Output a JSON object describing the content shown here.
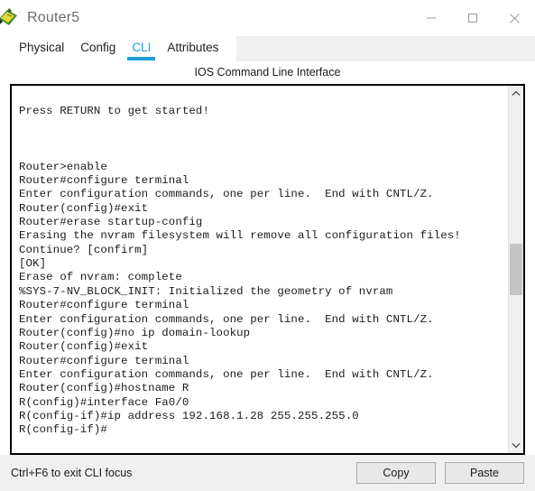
{
  "window": {
    "title": "Router5",
    "icon": "router-device-icon",
    "controls": {
      "minimize_label": "—",
      "maximize_label": "□",
      "close_label": "✕"
    }
  },
  "tabs": [
    {
      "label": "Physical",
      "active": false
    },
    {
      "label": "Config",
      "active": false
    },
    {
      "label": "CLI",
      "active": true
    },
    {
      "label": "Attributes",
      "active": false
    }
  ],
  "panel": {
    "title": "IOS Command Line Interface"
  },
  "terminal": {
    "lines": [
      "",
      "Press RETURN to get started!",
      "",
      "",
      "",
      "Router>enable",
      "Router#configure terminal",
      "Enter configuration commands, one per line.  End with CNTL/Z.",
      "Router(config)#exit",
      "Router#erase startup-config",
      "Erasing the nvram filesystem will remove all configuration files!",
      "Continue? [confirm]",
      "[OK]",
      "Erase of nvram: complete",
      "%SYS-7-NV_BLOCK_INIT: Initialized the geometry of nvram",
      "Router#configure terminal",
      "Enter configuration commands, one per line.  End with CNTL/Z.",
      "Router(config)#no ip domain-lookup",
      "Router(config)#exit",
      "Router#configure terminal",
      "Enter configuration commands, one per line.  End with CNTL/Z.",
      "Router(config)#hostname R",
      "R(config)#interface Fa0/0",
      "R(config-if)#ip address 192.168.1.28 255.255.255.0",
      "R(config-if)#"
    ]
  },
  "scrollbar": {
    "up_arrow": "chevron-up-icon",
    "down_arrow": "chevron-down-icon"
  },
  "footer": {
    "hint": "Ctrl+F6 to exit CLI focus",
    "copy_label": "Copy",
    "paste_label": "Paste"
  },
  "colors": {
    "accent": "#1a9fd4",
    "titlebar_text": "#6b6b6b",
    "terminal_text": "#1b1b1b",
    "panel_bg": "#f0f0f0"
  }
}
